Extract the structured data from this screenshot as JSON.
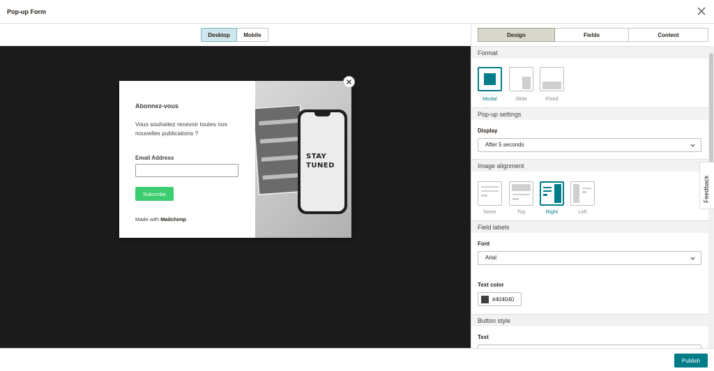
{
  "header": {
    "title": "Pop-up Form"
  },
  "preview": {
    "toggle": {
      "desktop": "Desktop",
      "mobile": "Mobile"
    },
    "popup": {
      "title": "Abonnez-vous",
      "description": "Vous souhaitez recevoir toutes nos nouvelles publications ?",
      "email_label": "Email Address",
      "email_value": "",
      "subscribe_label": "Subscribe",
      "made_with_prefix": "Made with",
      "made_with_brand": "Mailchimp",
      "image_text_line1": "STAY",
      "image_text_line2": "TUNED"
    }
  },
  "panel": {
    "tabs": [
      "Design",
      "Fields",
      "Content"
    ],
    "format": {
      "heading": "Format",
      "options": [
        "Modal",
        "Slide",
        "Fixed"
      ],
      "selected": "Modal"
    },
    "popup_settings": {
      "heading": "Pop-up settings",
      "display_label": "Display",
      "display_value": "After 5 seconds"
    },
    "image_alignment": {
      "heading": "Image alignment",
      "options": [
        "None",
        "Top",
        "Right",
        "Left"
      ],
      "selected": "Right"
    },
    "field_labels": {
      "heading": "Field labels",
      "font_label": "Font",
      "font_value": "Arial",
      "text_color_label": "Text color",
      "text_color_value": "#404040"
    },
    "button_style": {
      "heading": "Button style",
      "text_label": "Text"
    }
  },
  "feedback_label": "Feedback",
  "footer": {
    "publish_label": "Publish"
  },
  "colors": {
    "accent": "#007c89",
    "subscribe": "#3ccd6f",
    "canvas": "#1b1b1b"
  }
}
